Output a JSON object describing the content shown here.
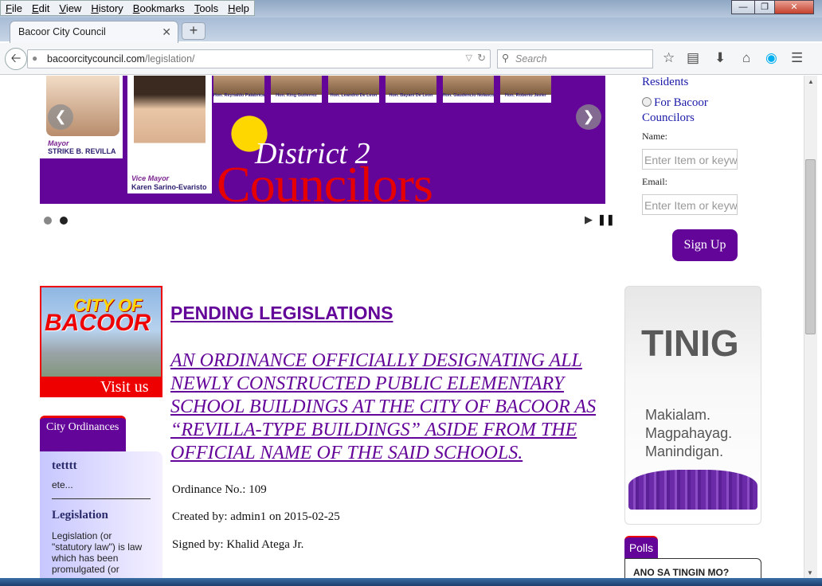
{
  "browser": {
    "menu": [
      "File",
      "Edit",
      "View",
      "History",
      "Bookmarks",
      "Tools",
      "Help"
    ],
    "tab_title": "Bacoor City Council",
    "url_host": "bacoorcitycouncil.com",
    "url_path": "/legislation/",
    "search_placeholder": "Search"
  },
  "slider": {
    "councilors": [
      "Hon. Reynaldo Palabrica",
      "Hon. King Gutierrez",
      "Hon. Leandro De Leon",
      "Hon. Bayani De Leon",
      "Hon. Gaudencio Nolasco",
      "Hon. Roberto Javier"
    ],
    "mayor_role": "Mayor",
    "mayor_name": "STRIKE B. REVILLA",
    "vice_role": "Vice Mayor",
    "vice_name": "Karen Sarino-Evaristo",
    "district": "District 2",
    "councilors_word": "Councilors"
  },
  "signup": {
    "residents": "Residents",
    "for_bacoor": "For Bacoor Councilors",
    "name_label": "Name:",
    "name_placeholder": "Enter Item or keyw",
    "email_label": "Email:",
    "email_placeholder": "Enter Item or keyw",
    "button": "Sign Up"
  },
  "visit": {
    "city_of": "CITY OF",
    "bacoor": "BACOOR",
    "visit_us": "Visit us"
  },
  "ordinances": {
    "tab": "City Ordinances",
    "item1_title": "tetttt",
    "item1_text": "ete...",
    "item2_title": "Legislation",
    "item2_text": "Legislation (or \"statutory law\") is law which has been promulgated (or"
  },
  "main": {
    "heading": "PENDING LEGISLATIONS",
    "ordinance_title": "AN ORDINANCE OFFICIALLY DESIGNATING ALL NEWLY CONSTRUCTED PUBLIC ELEMENTARY SCHOOL BUILDINGS AT THE CITY OF BACOOR AS “REVILLA-TYPE BUILDINGS” ASIDE FROM THE OFFICIAL NAME OF THE SAID SCHOOLS.",
    "ordinance_no": "Ordinance No.: 109",
    "created_by": "Created by: admin1 on 2015-02-25",
    "signed_by": "Signed by: Khalid Atega Jr."
  },
  "tinig": {
    "title": "TINIG",
    "line1": "Makialam.",
    "line2": "Magpahayag.",
    "line3": "Manindigan."
  },
  "polls": {
    "tab": "Polls",
    "question": "ANO SA TINGIN MO?"
  },
  "colors": {
    "brand_purple": "#64059a",
    "accent_red": "#e60000",
    "link_blue": "#1a1aa8"
  }
}
